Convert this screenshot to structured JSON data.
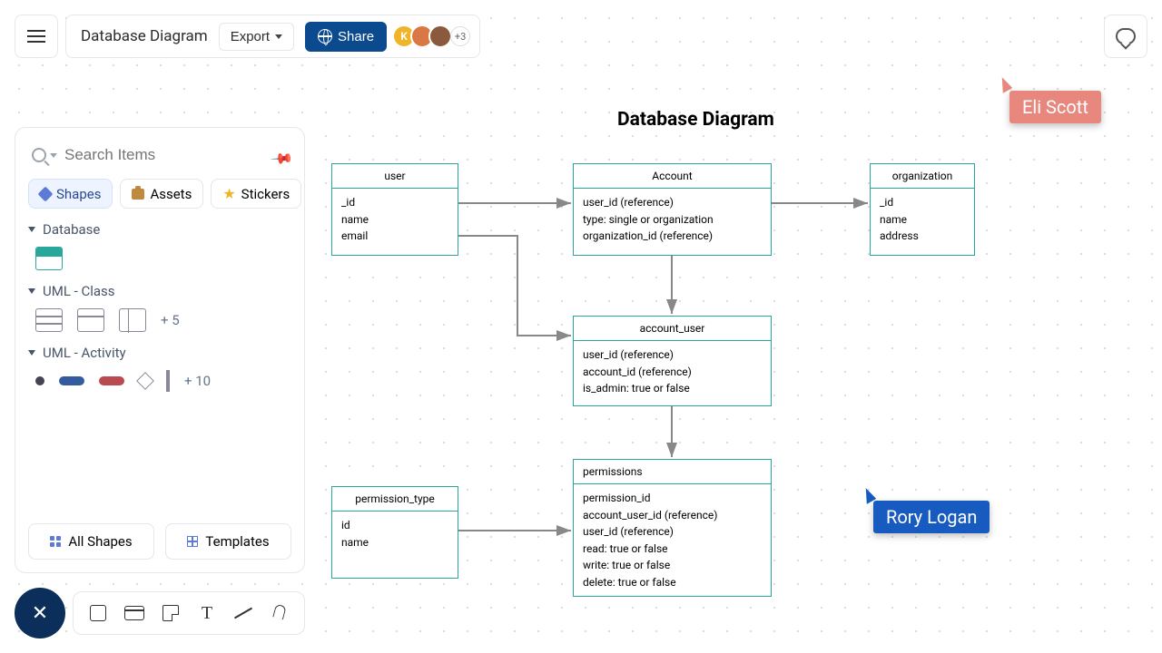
{
  "header": {
    "doc_title": "Database Diagram",
    "export_label": "Export",
    "share_label": "Share",
    "avatar_initial": "K",
    "avatar_more": "+3"
  },
  "sidebar": {
    "search_placeholder": "Search Items",
    "tabs": {
      "shapes": "Shapes",
      "assets": "Assets",
      "stickers": "Stickers"
    },
    "sections": {
      "database": {
        "label": "Database"
      },
      "uml_class": {
        "label": "UML - Class",
        "more": "+ 5"
      },
      "uml_activity": {
        "label": "UML - Activity",
        "more": "+ 10"
      }
    },
    "footer": {
      "all_shapes": "All Shapes",
      "templates": "Templates"
    }
  },
  "diagram": {
    "title": "Database Diagram",
    "entities": {
      "user": {
        "name": "user",
        "fields": [
          "_id",
          "name",
          "email"
        ]
      },
      "account": {
        "name": "Account",
        "fields": [
          "user_id (reference)",
          "type: single or organization",
          "organization_id (reference)"
        ]
      },
      "organization": {
        "name": "organization",
        "fields": [
          "_id",
          "name",
          "address"
        ]
      },
      "account_user": {
        "name": "account_user",
        "fields": [
          "user_id (reference)",
          "account_id (reference)",
          "is_admin: true or false"
        ]
      },
      "permissions": {
        "name": "permissions",
        "fields": [
          "permission_id",
          "account_user_id (reference)",
          "user_id (reference)",
          "read: true or false",
          "write: true or false",
          "delete: true or false"
        ]
      },
      "permission_type": {
        "name": "permission_type",
        "fields": [
          "id",
          "name"
        ]
      }
    }
  },
  "collaborators": {
    "c1": "Eli Scott",
    "c2": "Rory Logan"
  },
  "colors": {
    "teal": "#2aa79b",
    "share": "#0b4a8f",
    "fab": "#0b2f5a",
    "rory": "#175bc0",
    "eli": "#e8877d"
  }
}
